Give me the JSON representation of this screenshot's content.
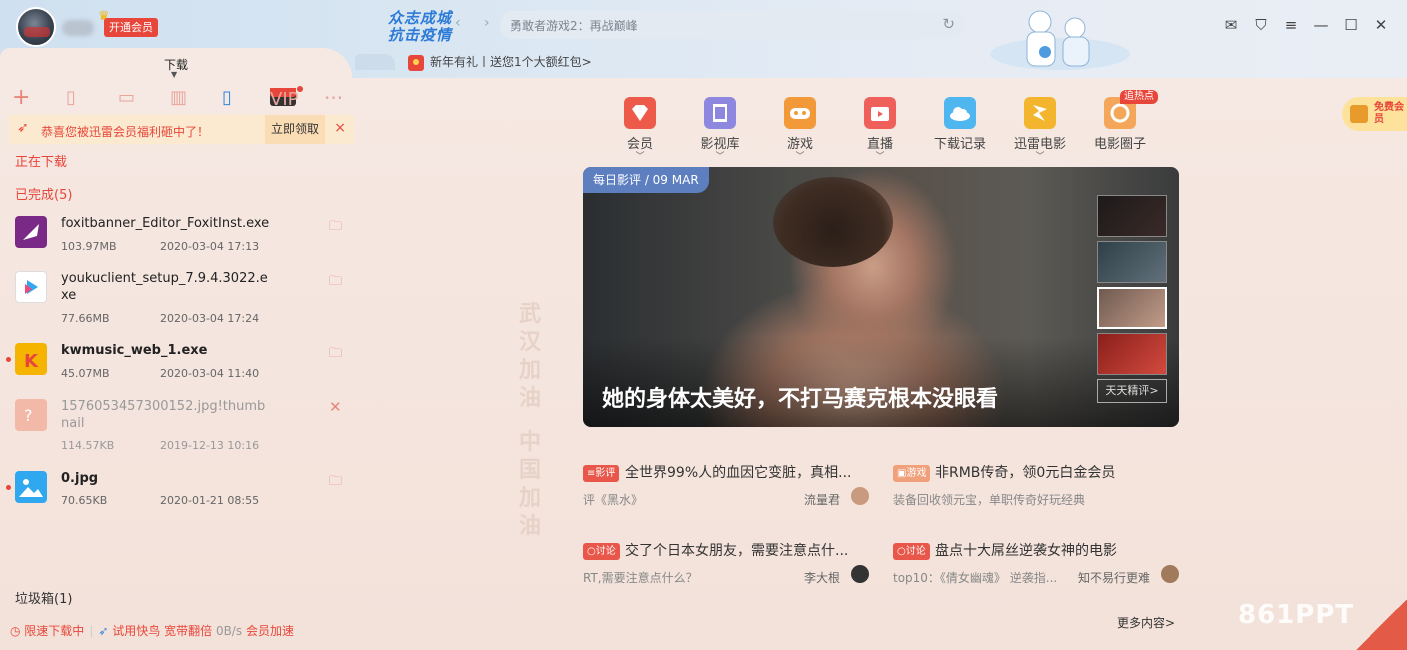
{
  "header": {
    "vip_label": "开通会员",
    "slogan_line1": "众志成城",
    "slogan_line2": "抗击疫情",
    "address": "勇敢者游戏2：再战巅峰",
    "promo": "新年有礼丨送您1个大额红包>",
    "window_controls": [
      "mail-icon",
      "shirt-icon",
      "menu-icon",
      "minimize-icon",
      "maximize-icon",
      "close-icon"
    ]
  },
  "left": {
    "tab_label": "下载",
    "toolbar": {
      "vip_badge": "VIP"
    },
    "notice": {
      "text": "恭喜您被迅雷会员福利砸中了！",
      "claim": "立即领取",
      "close": "×"
    },
    "downloading_label": "正在下载",
    "completed_label": "已完成(5)",
    "items": [
      {
        "name": "foxitbanner_Editor_FoxitInst.exe",
        "size": "103.97MB",
        "date": "2020-03-04 17:13",
        "icon": "foxit-icon",
        "action": "folder-icon"
      },
      {
        "name": "youkuclient_setup_7.9.4.3022.exe",
        "size": "77.66MB",
        "date": "2020-03-04 17:24",
        "icon": "youku-icon",
        "action": "folder-icon"
      },
      {
        "name": "kwmusic_web_1.exe",
        "size": "45.07MB",
        "date": "2020-03-04 11:40",
        "icon": "kuwo-icon",
        "action": "folder-icon"
      },
      {
        "name": "1576053457300152.jpg!thumbnail",
        "size": "114.57KB",
        "date": "2019-12-13 10:16",
        "icon": "broken-image-icon",
        "action": "delete-icon"
      },
      {
        "name": "0.jpg",
        "size": "70.65KB",
        "date": "2020-01-21 08:55",
        "icon": "image-file-icon",
        "action": "folder-icon"
      }
    ],
    "trash_label": "垃圾箱(1)",
    "status": {
      "limit": "限速下载中",
      "try_bird": "试用快鸟",
      "broadband": "宽带翻倍",
      "speed": "0B/s",
      "accel": "会员加速"
    }
  },
  "banner_watermark": {
    "line1": "武汉加油",
    "line2": "中国加油"
  },
  "nav": {
    "items": [
      {
        "label": "会员",
        "has_caret": true,
        "color": "#ee5a4a"
      },
      {
        "label": "影视库",
        "has_caret": true,
        "color": "#8e87e0"
      },
      {
        "label": "游戏",
        "has_caret": true,
        "color": "#f29a3a"
      },
      {
        "label": "直播",
        "has_caret": true,
        "color": "#f0605b"
      },
      {
        "label": "下载记录",
        "has_caret": false,
        "color": "#4fb6ef"
      },
      {
        "label": "迅雷电影",
        "has_caret": true,
        "color": "#f3b52e"
      },
      {
        "label": "电影圈子",
        "has_caret": false,
        "color": "#f4a75a"
      }
    ],
    "hot_tag": "追热点"
  },
  "free_vip": "免费会员",
  "hero": {
    "tag": "每日影评 / 09 MAR",
    "caption": "她的身体太美好，不打马赛克根本没眼看",
    "more": "天天精评>"
  },
  "news": [
    {
      "badge": "影评",
      "badge_color": "#e8574a",
      "title": "全世界99%人的血因它变脏，真相...",
      "sub": "评《黑水》",
      "author": "流量君"
    },
    {
      "badge": "游戏",
      "badge_color": "#f0a07a",
      "title": "非RMB传奇，领0元白金会员",
      "sub": "装备回收领元宝，单职传奇好玩经典",
      "author": ""
    },
    {
      "badge": "讨论",
      "badge_color": "#e8574a",
      "title": "交了个日本女朋友，需要注意点什...",
      "sub": "RT,需要注意点什么？",
      "author": "李大根"
    },
    {
      "badge": "讨论",
      "badge_color": "#e8574a",
      "title": "盘点十大屌丝逆袭女神的电影",
      "sub": "top10：《倩女幽魂》 逆袭指...",
      "author": "知不易行更难"
    }
  ],
  "more_content": "更多内容>",
  "brand_watermark": "861PPT"
}
